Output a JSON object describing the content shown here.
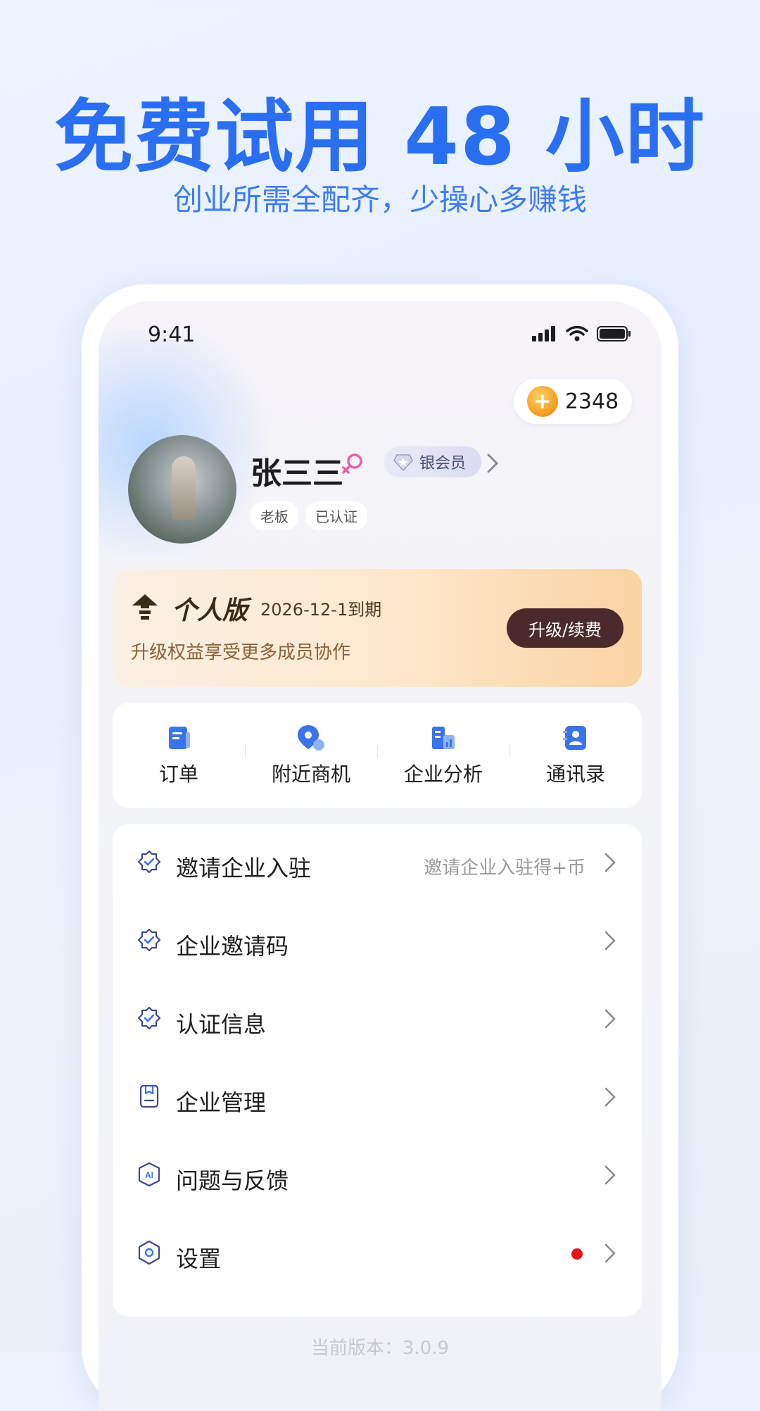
{
  "promo": {
    "title": "免费试用 48 小时",
    "subtitle": "创业所需全配齐，少操心多赚钱"
  },
  "status_bar": {
    "time": "9:41"
  },
  "coins": {
    "value": "2348"
  },
  "profile": {
    "name": "张三三",
    "member_level": "银会员",
    "tags": [
      "老板",
      "已认证"
    ]
  },
  "vip_card": {
    "title": "个人版",
    "expire": "2026-12-1到期",
    "description": "升级权益享受更多成员协作",
    "button": "升级/续费"
  },
  "shortcuts": [
    {
      "label": "订单",
      "icon": "order-icon"
    },
    {
      "label": "附近商机",
      "icon": "location-icon"
    },
    {
      "label": "企业分析",
      "icon": "analysis-icon"
    },
    {
      "label": "通讯录",
      "icon": "contacts-icon"
    }
  ],
  "menu": [
    {
      "label": "邀请企业入驻",
      "hint": "邀请企业入驻得+币",
      "icon": "badge-check-icon"
    },
    {
      "label": "企业邀请码",
      "icon": "badge-check-icon"
    },
    {
      "label": "认证信息",
      "icon": "badge-check-icon"
    },
    {
      "label": "企业管理",
      "icon": "document-icon"
    },
    {
      "label": "问题与反馈",
      "icon": "ai-shield-icon"
    },
    {
      "label": "设置",
      "icon": "hexagon-settings-icon",
      "badge": "red-dot"
    }
  ],
  "footer": {
    "version": "当前版本：3.0.9"
  },
  "colors": {
    "accent": "#2a6ef2",
    "icon_blue": "#3a74e8",
    "vip_button": "#4a2a2a",
    "red_dot": "#e5141b"
  }
}
